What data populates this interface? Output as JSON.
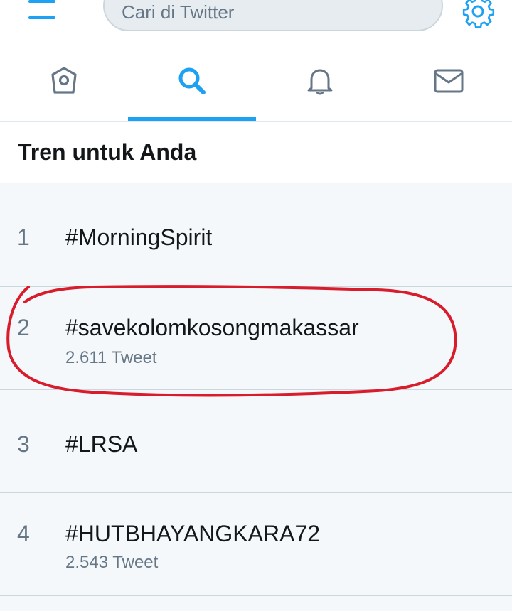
{
  "header": {
    "search_placeholder": "Cari di Twitter",
    "menu_icon": "hamburger-menu-icon",
    "settings_icon": "gear-icon"
  },
  "tabs": [
    {
      "name": "home",
      "icon": "home-icon",
      "active": false
    },
    {
      "name": "search",
      "icon": "search-icon",
      "active": true
    },
    {
      "name": "notifications",
      "icon": "bell-icon",
      "active": false
    },
    {
      "name": "messages",
      "icon": "envelope-icon",
      "active": false
    }
  ],
  "section": {
    "title": "Tren untuk Anda"
  },
  "trends": [
    {
      "rank": "1",
      "tag": "#MorningSpirit",
      "count": ""
    },
    {
      "rank": "2",
      "tag": "#savekolomkosongmakassar",
      "count": "2.611 Tweet"
    },
    {
      "rank": "3",
      "tag": "#LRSA",
      "count": ""
    },
    {
      "rank": "4",
      "tag": "#HUTBHAYANGKARA72",
      "count": "2.543 Tweet"
    }
  ],
  "colors": {
    "accent": "#1da1f2",
    "background": "#f5f8fa",
    "secondary_text": "#657786",
    "annotation": "#d81c2c"
  }
}
